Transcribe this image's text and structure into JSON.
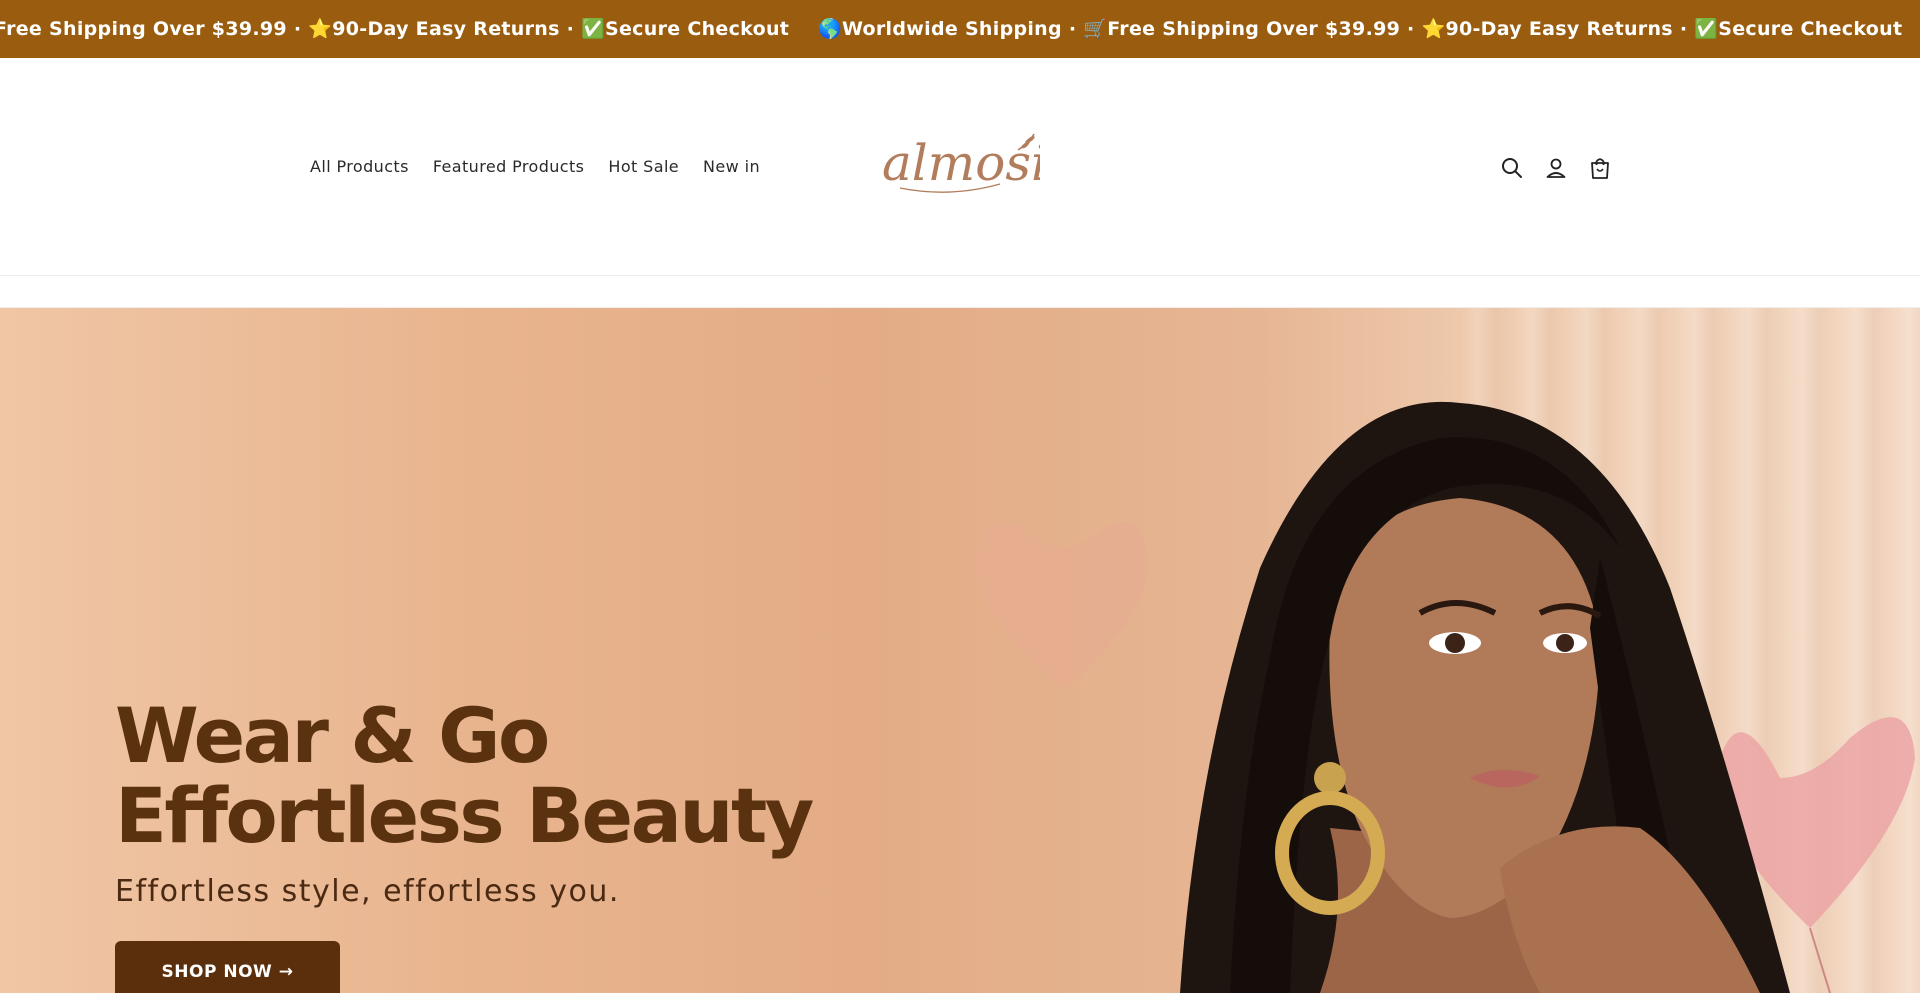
{
  "announcement": {
    "segment_1": "Free Shipping Over $39.99 · ⭐90-Day Easy Returns · ✅Secure Checkout",
    "segment_2": "🌎Worldwide Shipping · 🛒Free Shipping Over $39.99 · ⭐90-Day Easy Returns · ✅Secure Checkout"
  },
  "nav": {
    "items": [
      {
        "label": "All Products"
      },
      {
        "label": "Featured Products"
      },
      {
        "label": "Hot Sale"
      },
      {
        "label": "New in"
      }
    ]
  },
  "logo": {
    "text": "almosip",
    "icon": "wheat-leaf-icon"
  },
  "header_icons": [
    "search-icon",
    "account-icon",
    "cart-icon"
  ],
  "hero": {
    "title_line_1": "Wear & Go",
    "title_line_2": "Effortless Beauty",
    "subtitle": "Effortless style, effortless you.",
    "cta_label": "SHOP NOW →",
    "image": "woman-with-long-black-hair-and-gold-hoop-earring"
  },
  "colors": {
    "announcement_bg": "#9a5d0f",
    "hero_title": "#5a3210",
    "cta_bg": "#5b2f0c",
    "logo": "#b27d5c"
  }
}
